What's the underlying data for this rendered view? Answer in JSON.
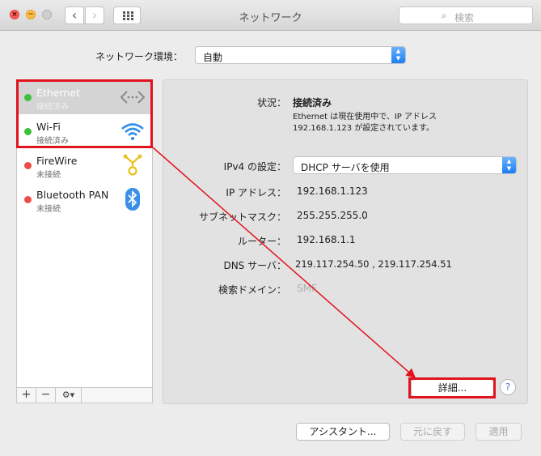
{
  "window": {
    "title": "ネットワーク",
    "search_placeholder": "検索",
    "traffic_lights": [
      "close",
      "minimize",
      "zoom"
    ],
    "nav": {
      "back": "‹",
      "forward": "›"
    }
  },
  "location": {
    "label": "ネットワーク環境：",
    "value": "自動"
  },
  "services": [
    {
      "name": "Ethernet",
      "status": "接続済み",
      "status_color": "#3cc13b",
      "icon": "ethernet-icon"
    },
    {
      "name": "Wi-Fi",
      "status": "接続済み",
      "status_color": "#3cc13b",
      "icon": "wifi-icon"
    },
    {
      "name": "FireWire",
      "status": "未接続",
      "status_color": "#ef4b48",
      "icon": "firewire-icon"
    },
    {
      "name": "Bluetooth PAN",
      "status": "未接続",
      "status_color": "#ef4b48",
      "icon": "bluetooth-icon"
    }
  ],
  "sidebar_controls": {
    "add": "+",
    "remove": "−",
    "action": "⚙︎▾"
  },
  "details": {
    "status_label": "状況：",
    "status_value": "接続済み",
    "status_note_line1": "Ethernet は現在使用中で、IP アドレス",
    "status_note_line2": "192.168.1.123 が設定されています。",
    "ipv4_label": "IPv4 の設定：",
    "ipv4_value": "DHCP サーバを使用",
    "ip_label": "IP アドレス：",
    "ip_value": "192.168.1.123",
    "subnet_label": "サブネットマスク：",
    "subnet_value": "255.255.255.0",
    "router_label": "ルーター：",
    "router_value": "192.168.1.1",
    "dns_label": "DNS サーバ：",
    "dns_value": "219.117.254.50 , 219.117.254.51",
    "domain_label": "検索ドメイン：",
    "domain_value": "SMF",
    "advanced_button": "詳細...",
    "help": "?"
  },
  "footer": {
    "assistant": "アシスタント...",
    "revert": "元に戻す",
    "apply": "適用"
  },
  "colors": {
    "annotation_red": "#e0141e",
    "accent_blue": "#1b7ef5"
  }
}
